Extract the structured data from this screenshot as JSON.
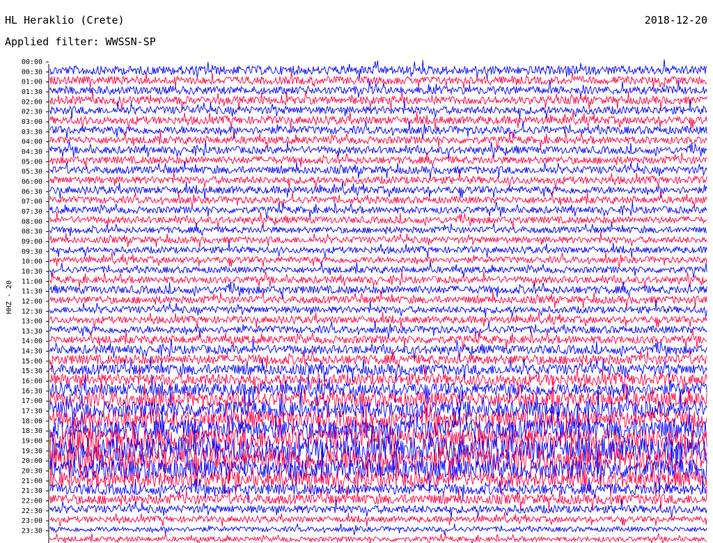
{
  "header": {
    "station": "HL Heraklio (Crete)",
    "date": "2018-12-20",
    "filter": "Applied filter: WWSSN-SP"
  },
  "chart_data": {
    "type": "line",
    "ylabel": "HHZ - 20",
    "row_labels": [
      "00:00",
      "00:30",
      "01:00",
      "01:30",
      "02:00",
      "02:30",
      "03:00",
      "03:30",
      "04:00",
      "04:30",
      "05:00",
      "05:30",
      "06:00",
      "06:30",
      "07:00",
      "07:30",
      "08:00",
      "08:30",
      "09:00",
      "09:30",
      "10:00",
      "10:30",
      "11:00",
      "11:30",
      "12:00",
      "12:30",
      "13:00",
      "13:30",
      "14:00",
      "14:30",
      "15:00",
      "15:30",
      "16:00",
      "16:30",
      "17:00",
      "17:30",
      "18:00",
      "18:30",
      "19:00",
      "19:30",
      "20:00",
      "20:30",
      "21:00",
      "21:30",
      "22:00",
      "22:30",
      "23:00",
      "23:30"
    ],
    "colors": [
      "#0000ff",
      "#ff0040"
    ],
    "relative_amplitude": [
      0.9,
      0.8,
      0.8,
      0.8,
      0.8,
      0.8,
      0.8,
      0.75,
      0.75,
      0.75,
      0.75,
      0.75,
      0.75,
      0.7,
      0.7,
      0.7,
      0.65,
      0.65,
      0.65,
      0.65,
      0.65,
      0.7,
      0.8,
      0.75,
      0.7,
      0.7,
      0.75,
      0.8,
      0.9,
      1.0,
      1.1,
      1.2,
      1.3,
      1.5,
      1.7,
      1.8,
      2.0,
      2.2,
      2.5,
      2.4,
      2.0,
      1.6,
      1.1,
      1.0,
      0.8,
      0.6,
      0.5,
      0.5
    ],
    "grid": false,
    "legend": "none"
  }
}
